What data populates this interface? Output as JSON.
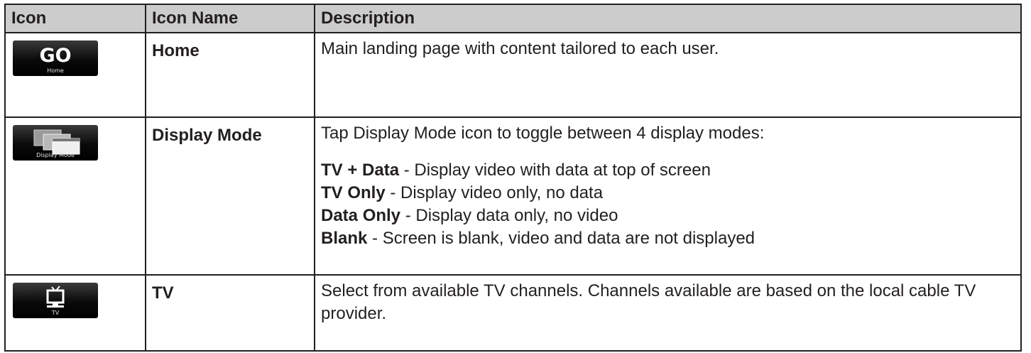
{
  "headers": [
    "Icon",
    "Icon Name",
    "Description"
  ],
  "rows": [
    {
      "icon": "home-icon",
      "icon_caption": "Home",
      "name": "Home",
      "description": "Main landing page with content tailored to each user."
    },
    {
      "icon": "display-mode-icon",
      "icon_caption": "Display Mode",
      "name": "Display Mode",
      "description": "Tap Display Mode icon to toggle between 4 display modes:",
      "modes": [
        {
          "label": "TV + Data",
          "text": " - Display video with data at top of screen"
        },
        {
          "label": "TV Only",
          "text": " - Display video only, no data"
        },
        {
          "label": "Data Only",
          "text": " - Display data only, no video"
        },
        {
          "label": "Blank",
          "text": " - Screen is blank, video and data are not displayed"
        }
      ]
    },
    {
      "icon": "tv-icon",
      "icon_caption": "TV",
      "name": "TV",
      "description": "Select from available TV channels. Channels available are based on the local cable TV provider."
    }
  ]
}
